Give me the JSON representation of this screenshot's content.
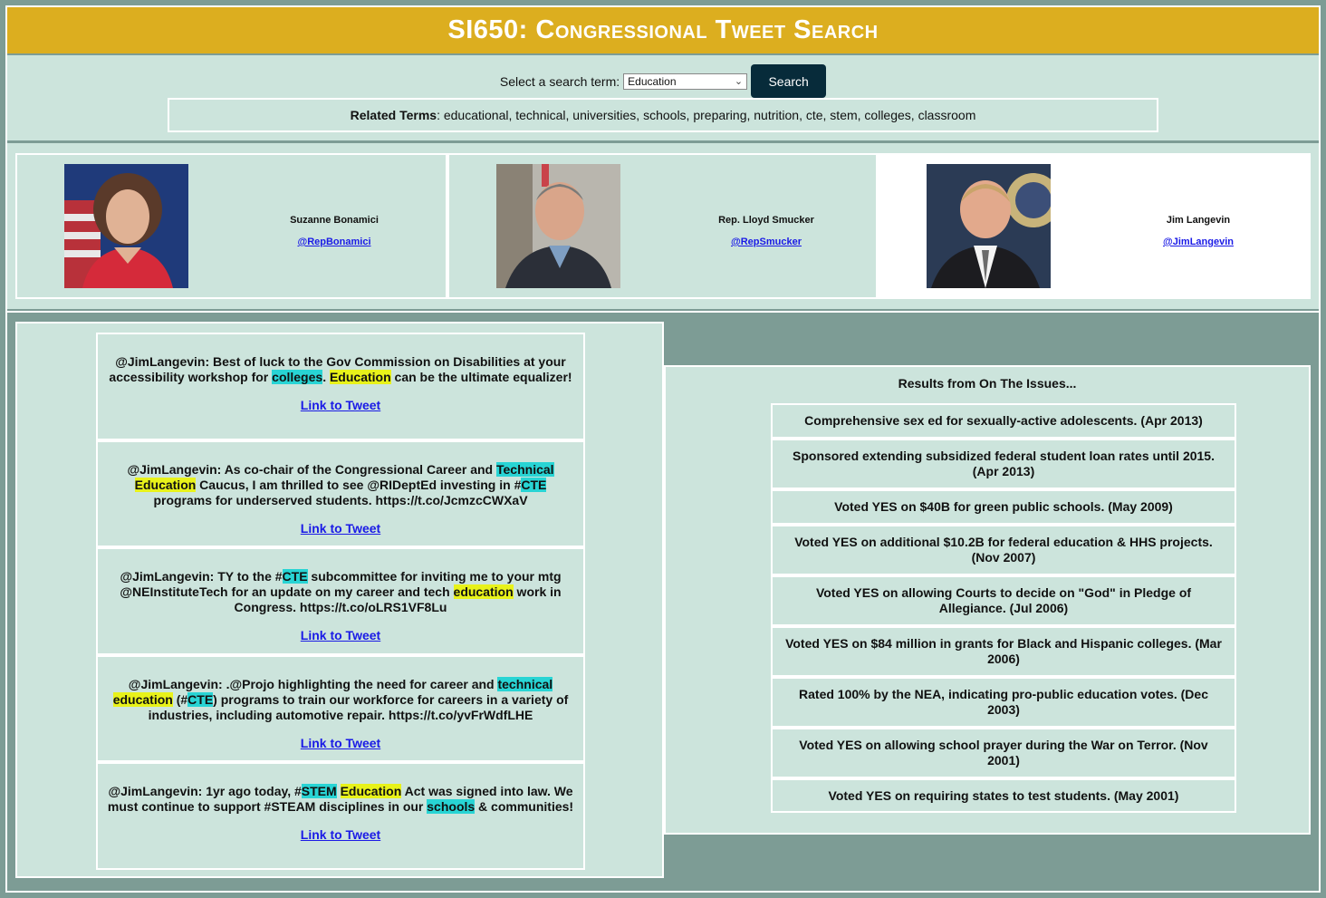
{
  "header": {
    "title": "SI650: Congressional Tweet Search"
  },
  "search": {
    "label": "Select a search term:",
    "selected": "Education",
    "button": "Search"
  },
  "related": {
    "label": "Related Terms",
    "terms": ": educational, technical, universities, schools, preparing, nutrition, cte, stem, colleges, classroom"
  },
  "reps": [
    {
      "name": "Suzanne Bonamici",
      "handle": "@RepBonamici"
    },
    {
      "name": "Rep. Lloyd Smucker",
      "handle": "@RepSmucker"
    },
    {
      "name": "Jim Langevin",
      "handle": "@JimLangevin"
    }
  ],
  "tweets": {
    "link_label": "Link to Tweet",
    "t0": [
      "@JimLangevin: Best of luck to the Gov Commission on Disabilities at your accessibility workshop for ",
      "colleges",
      ". ",
      "Education",
      " can be the ultimate equalizer!"
    ],
    "t1": [
      "@JimLangevin: As co-chair of the Congressional Career and ",
      "Technical",
      " ",
      "Education",
      " Caucus, I am thrilled to see @RIDeptEd investing in #",
      "CTE",
      " programs for underserved students. https://t.co/JcmzcCWXaV"
    ],
    "t2": [
      "@JimLangevin: TY to the #",
      "CTE",
      " subcommittee for inviting me to your mtg @NEInstituteTech for an update on my career and tech ",
      "education",
      " work in Congress. https://t.co/oLRS1VF8Lu"
    ],
    "t3": [
      "@JimLangevin: .@Projo highlighting the need for career and ",
      "technical",
      " ",
      "education",
      " (#",
      "CTE",
      ") programs to train our workforce for careers in a variety of industries, including automotive repair. https://t.co/yvFrWdfLHE"
    ],
    "t4": [
      "@JimLangevin: 1yr ago today, #",
      "STEM",
      " ",
      "Education",
      " Act was signed into law. We must continue to support #STEAM disciplines in our ",
      "schools",
      " & communities!"
    ]
  },
  "issues": {
    "title": "Results from On The Issues...",
    "items": [
      "Comprehensive sex ed for sexually-active adolescents. (Apr 2013)",
      "Sponsored extending subsidized federal student loan rates until 2015. (Apr 2013)",
      "Voted YES on $40B for green public schools. (May 2009)",
      "Voted YES on additional $10.2B for federal education & HHS projects. (Nov 2007)",
      "Voted YES on allowing Courts to decide on \"God\" in Pledge of Allegiance. (Jul 2006)",
      "Voted YES on $84 million in grants for Black and Hispanic colleges. (Mar 2006)",
      "Rated 100% by the NEA, indicating pro-public education votes. (Dec 2003)",
      "Voted YES on allowing school prayer during the War on Terror. (Nov 2001)",
      "Voted YES on requiring states to test students. (May 2001)"
    ]
  },
  "colors": {
    "header": "#dcae1f",
    "panel": "#cce4dc",
    "background": "#7d9c95",
    "button": "#072b3a",
    "highlight_yellow": "#e8f21a",
    "highlight_cyan": "#28d4d4"
  }
}
